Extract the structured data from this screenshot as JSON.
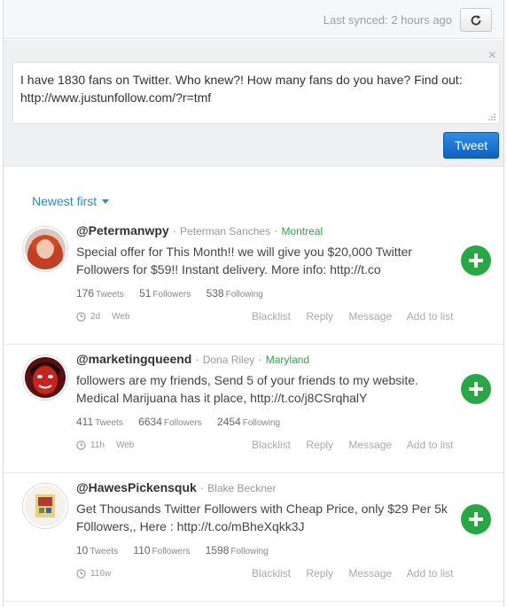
{
  "header": {
    "sync_text": "Last synced: 2 hours ago",
    "refresh_icon": "refresh-icon"
  },
  "compose": {
    "close_glyph": "×",
    "text": "I have 1830 fans on Twitter. Who knew?! How many fans do you have? Find out: http://www.justunfollow.com/?r=tmf",
    "tweet_label": "Tweet"
  },
  "sort": {
    "label": "Newest first"
  },
  "colors": {
    "accent_blue": "#2a8ad4",
    "tweet_button": "#1a73d0",
    "add_green": "#28a745",
    "location_green": "#2ea64a"
  },
  "items": [
    {
      "handle": "@Petermanwpy",
      "name": "Peterman Sanches",
      "location": "Montreal",
      "text": "Special offer for This Month!! we will give you $20,000 Twitter Followers for $59!! Instant delivery. More info: http://t.co",
      "tweets": "176",
      "followers": "51",
      "following": "538",
      "age": "2d",
      "source": "Web"
    },
    {
      "handle": "@marketingqueend",
      "name": "Dona Riley",
      "location": "Maryland",
      "text": "followers are my friends, Send 5 of your friends to my website. Medical Marijuana has it place, http://t.co/j8CSrqhalY",
      "tweets": "411",
      "followers": "6634",
      "following": "2454",
      "age": "11h",
      "source": "Web"
    },
    {
      "handle": "@HawesPickensquk",
      "name": "Blake Beckner",
      "location": "",
      "text": "Get Thousands Twitter Followers with Cheap Price, only $29 Per 5k F0llowers,, Here : http://t.co/mBheXqkk3J",
      "tweets": "10",
      "followers": "110",
      "following": "1598",
      "age": "116w",
      "source": ""
    }
  ],
  "labels": {
    "tweets": "Tweets",
    "followers": "Followers",
    "following": "Following",
    "blacklist": "Blacklist",
    "reply": "Reply",
    "message": "Message",
    "add_to_list": "Add to list"
  }
}
